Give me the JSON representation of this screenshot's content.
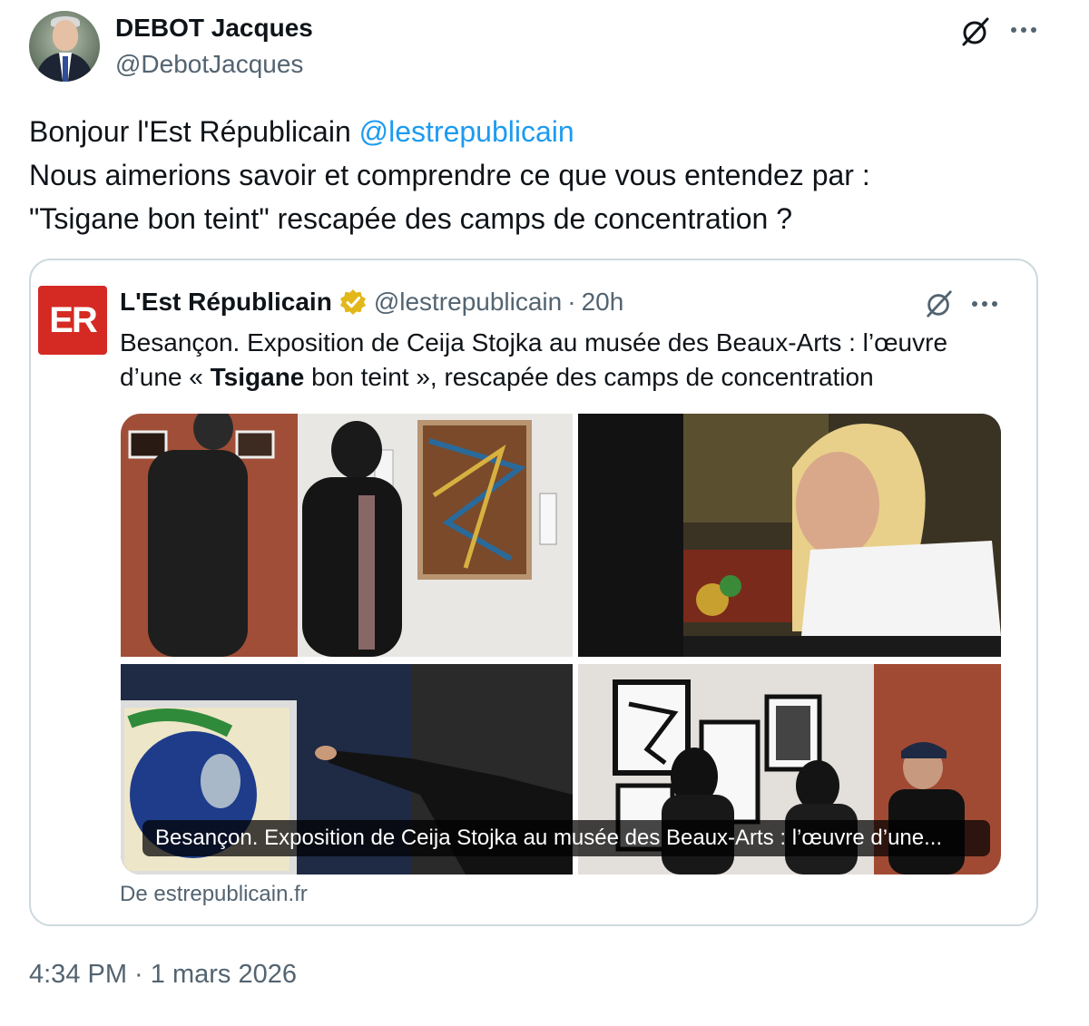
{
  "author": {
    "name": "DEBOT Jacques",
    "handle": "@DebotJacques"
  },
  "tweet": {
    "line1_prefix": "Bonjour l'Est Républicain ",
    "line1_mention": "@lestrepublicain",
    "line2": "Nous aimerions savoir et comprendre ce que vous entendez par :",
    "line3": "\"Tsigane bon teint\" rescapée des camps de concentration ?"
  },
  "quoted": {
    "logo_text": "ER",
    "name": "L'Est Républicain",
    "handle": "@lestrepublicain",
    "separator": "·",
    "age": "20h",
    "text_line1": "Besançon. Exposition de Ceija Stojka au musée des Beaux-Arts : l’œuvre",
    "text_line2_pre": "d’une « ",
    "text_line2_bold": "Tsigane",
    "text_line2_post": " bon teint », rescapée des camps de concentration",
    "card_caption": "Besançon. Exposition de Ceija Stojka au musée des Beaux-Arts : l’œuvre d’une...",
    "source": "De estrepublicain.fr"
  },
  "timestamp": {
    "time": "4:34 PM",
    "separator": " · ",
    "date": "1 mars 2026"
  },
  "colors": {
    "accent": "#1d9bf0",
    "muted": "#536471",
    "border": "#cfd9de",
    "brand_red": "#d42a23",
    "verified_gold": "#e2b719"
  },
  "icons": [
    "grok-icon",
    "more-icon",
    "verified-badge-icon"
  ]
}
